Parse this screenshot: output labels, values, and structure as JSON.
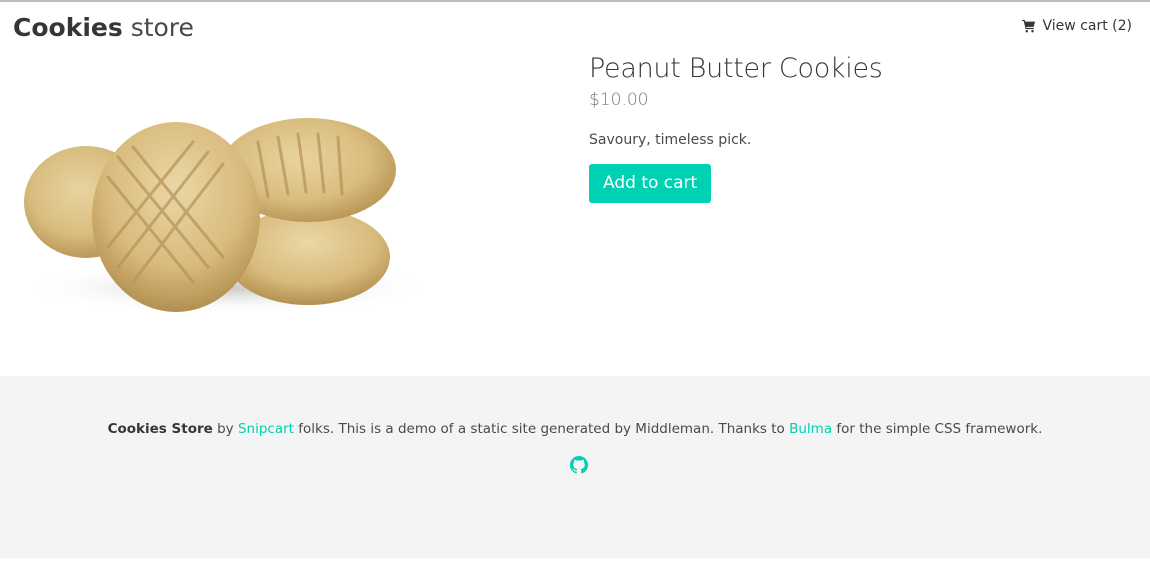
{
  "nav": {
    "brand_bold": "Cookies",
    "brand_light": "store",
    "cart_icon": "shopping-cart-icon",
    "cart_label": "View cart (2)"
  },
  "product": {
    "image_icon": "peanut-butter-cookies-image",
    "title": "Peanut Butter Cookies",
    "price": "$10.00",
    "description": "Savoury, timeless pick.",
    "add_to_cart_label": "Add to cart"
  },
  "footer": {
    "store_name": "Cookies Store",
    "text_by": "by",
    "snipcart_link": "Snipcart",
    "text_middle": "folks. This is a demo of a static site generated by Middleman. Thanks to",
    "bulma_link": "Bulma",
    "text_end": "for the simple CSS framework.",
    "github_icon": "github-icon"
  },
  "colors": {
    "accent": "#00d1b2",
    "footer_bg": "#f4f4f4",
    "text": "#4a4a4a",
    "heading": "#363636"
  }
}
